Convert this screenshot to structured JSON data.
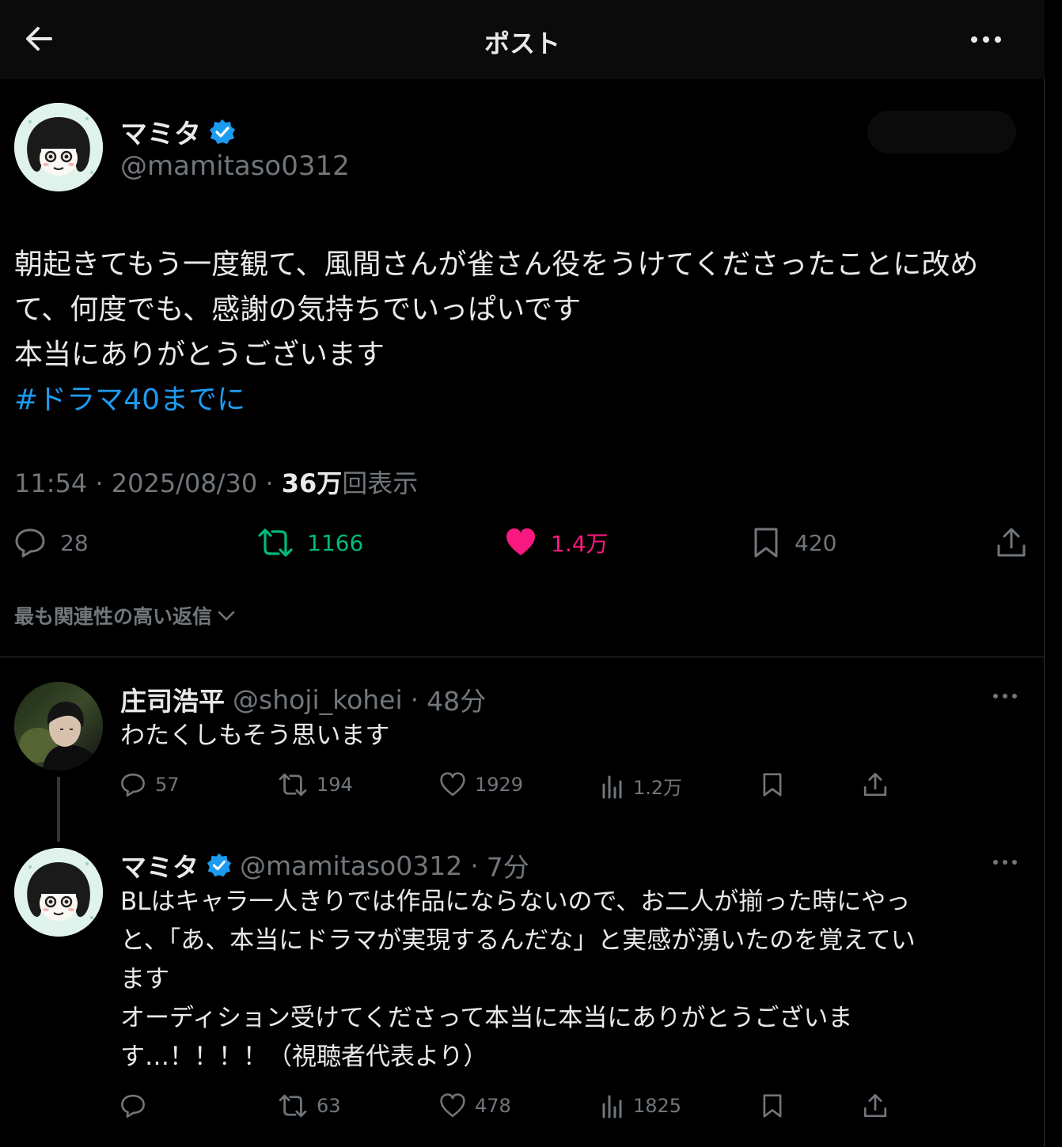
{
  "header": {
    "title": "ポスト"
  },
  "post": {
    "author_name": "マミタ",
    "author_handle": "@mamitaso0312",
    "body_lines": [
      "朝起きてもう一度観て、風間さんが雀さん役をうけてくださったことに改め",
      "て、何度でも、感謝の気持ちでいっぱいです",
      "本当にありがとうございます"
    ],
    "hashtag": "#ドラマ40までに",
    "time": "11:54",
    "date": "2025/08/30",
    "views_count": "36万",
    "views_label": "回表示",
    "replies": "28",
    "reposts": "1166",
    "likes": "1.4万",
    "bookmarks": "420"
  },
  "replies_filter": {
    "label": "最も関連性の高い返信"
  },
  "replies": [
    {
      "name": "庄司浩平",
      "handle": "@shoji_kohei",
      "time": "48分",
      "text_lines": [
        "わたくしもそう思います"
      ],
      "replies": "57",
      "reposts": "194",
      "likes": "1929",
      "views": "1.2万"
    },
    {
      "name": "マミタ",
      "handle": "@mamitaso0312",
      "time": "7分",
      "text_lines": [
        "BLはキャラ一人きりでは作品にならないので、お二人が揃った時にやっ",
        "と、「あ、本当にドラマが実現するんだな」と実感が湧いたのを覚えてい",
        "ます",
        "オーディション受けてくださって本当に本当にありがとうございま",
        "す…！！！！（視聴者代表より）"
      ],
      "replies": "",
      "reposts": "63",
      "likes": "478",
      "views": "1825"
    }
  ],
  "colors": {
    "accent": "#1d9bf0",
    "like_active": "#f91880",
    "repost_active": "#00ba7c",
    "muted": "#71767b",
    "text": "#e7e9ea"
  },
  "icons": {
    "back": "arrow-left-icon",
    "more": "more-horizontal-icon",
    "verified": "verified-badge-icon",
    "reply": "speech-bubble-icon",
    "repost": "repost-icon",
    "like": "heart-icon",
    "bookmark": "bookmark-icon",
    "share": "share-icon",
    "views": "bar-chart-icon",
    "chevron": "chevron-down-icon"
  }
}
